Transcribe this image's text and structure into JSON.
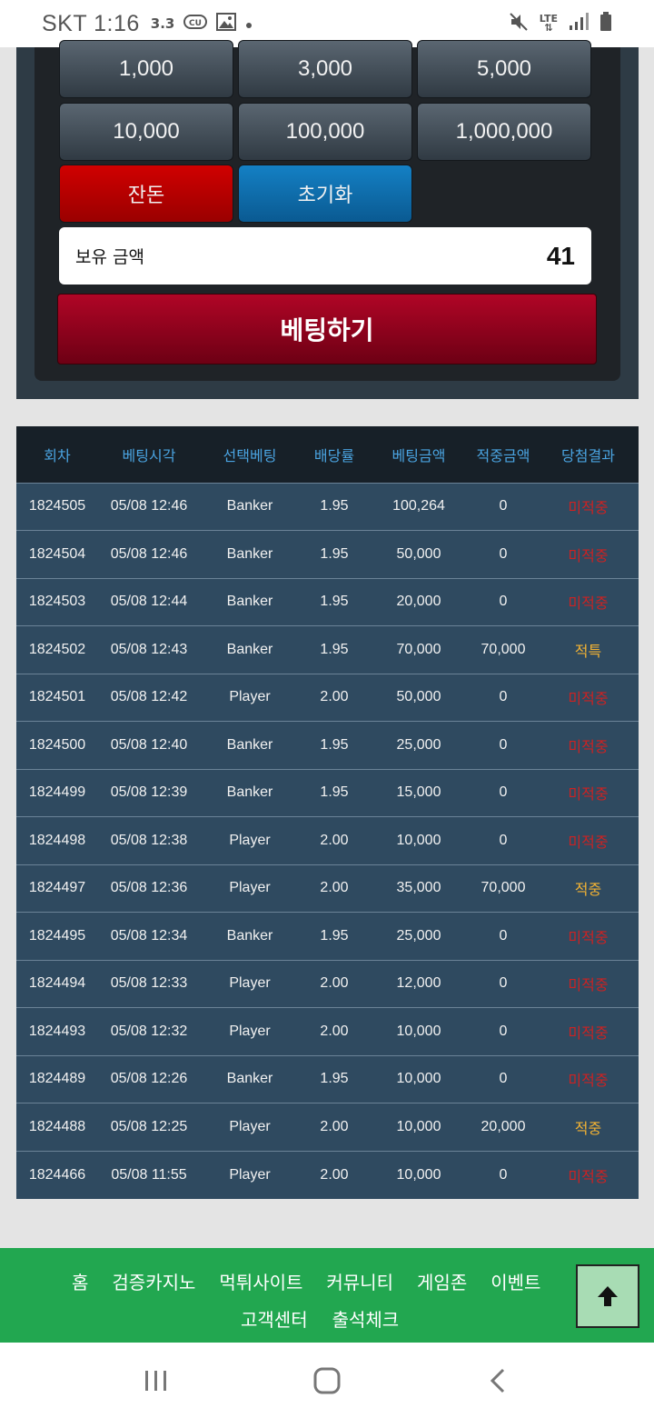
{
  "status_bar": {
    "carrier_time": "SKT 1:16",
    "speed": "3.3",
    "lte": "LTE"
  },
  "chips": [
    [
      "1,000",
      "3,000",
      "5,000"
    ],
    [
      "10,000",
      "100,000",
      "1,000,000"
    ]
  ],
  "buttons": {
    "balance_all": "잔돈",
    "reset": "초기화",
    "bet": "베팅하기"
  },
  "balance": {
    "label": "보유 금액",
    "value": "41"
  },
  "table": {
    "headers": [
      "회차",
      "베팅시각",
      "선택베팅",
      "배당률",
      "베팅금액",
      "적중금액",
      "당첨결과"
    ],
    "rows": [
      [
        "1824505",
        "05/08 12:46",
        "Banker",
        "1.95",
        "100,264",
        "0",
        "미적중"
      ],
      [
        "1824504",
        "05/08 12:46",
        "Banker",
        "1.95",
        "50,000",
        "0",
        "미적중"
      ],
      [
        "1824503",
        "05/08 12:44",
        "Banker",
        "1.95",
        "20,000",
        "0",
        "미적중"
      ],
      [
        "1824502",
        "05/08 12:43",
        "Banker",
        "1.95",
        "70,000",
        "70,000",
        "적특"
      ],
      [
        "1824501",
        "05/08 12:42",
        "Player",
        "2.00",
        "50,000",
        "0",
        "미적중"
      ],
      [
        "1824500",
        "05/08 12:40",
        "Banker",
        "1.95",
        "25,000",
        "0",
        "미적중"
      ],
      [
        "1824499",
        "05/08 12:39",
        "Banker",
        "1.95",
        "15,000",
        "0",
        "미적중"
      ],
      [
        "1824498",
        "05/08 12:38",
        "Player",
        "2.00",
        "10,000",
        "0",
        "미적중"
      ],
      [
        "1824497",
        "05/08 12:36",
        "Player",
        "2.00",
        "35,000",
        "70,000",
        "적중"
      ],
      [
        "1824495",
        "05/08 12:34",
        "Banker",
        "1.95",
        "25,000",
        "0",
        "미적중"
      ],
      [
        "1824494",
        "05/08 12:33",
        "Player",
        "2.00",
        "12,000",
        "0",
        "미적중"
      ],
      [
        "1824493",
        "05/08 12:32",
        "Player",
        "2.00",
        "10,000",
        "0",
        "미적중"
      ],
      [
        "1824489",
        "05/08 12:26",
        "Banker",
        "1.95",
        "10,000",
        "0",
        "미적중"
      ],
      [
        "1824488",
        "05/08 12:25",
        "Player",
        "2.00",
        "10,000",
        "20,000",
        "적중"
      ],
      [
        "1824466",
        "05/08 11:55",
        "Player",
        "2.00",
        "10,000",
        "0",
        "미적중"
      ]
    ]
  },
  "footer": {
    "row1": [
      "홈",
      "검증카지노",
      "먹튀사이트",
      "커뮤니티",
      "게임존",
      "이벤트"
    ],
    "row2": [
      "고객센터",
      "출석체크"
    ]
  },
  "colors": {
    "lose": "#cc2222",
    "win": "#f2b233",
    "footer": "#22a750",
    "header_text": "#4aa3e0"
  },
  "icons": [
    "gallery-icon",
    "mute-icon",
    "signal-icon",
    "battery-icon",
    "arrow-up-icon",
    "recents-icon",
    "home-icon",
    "back-icon"
  ]
}
